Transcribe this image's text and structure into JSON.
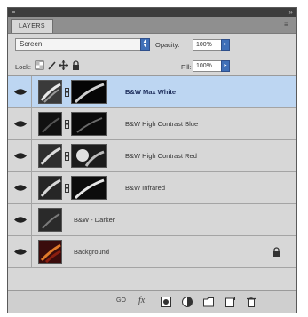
{
  "panel": {
    "tab_label": "LAYERS",
    "blend_mode": "Screen",
    "opacity_label": "Opacity:",
    "opacity_value": "100%",
    "lock_label": "Lock:",
    "fill_label": "Fill:",
    "fill_value": "100%"
  },
  "layers": [
    {
      "name": "B&W Max White",
      "selected": true,
      "bold": true
    },
    {
      "name": "B&W High Contrast Blue",
      "selected": false
    },
    {
      "name": "B&W High Contrast Red",
      "selected": false
    },
    {
      "name": "B&W Infrared",
      "selected": false
    },
    {
      "name": "B&W - Darker",
      "selected": false
    },
    {
      "name": "Background",
      "selected": false
    }
  ],
  "footer": {
    "link_label": "GO"
  },
  "colors": {
    "selection": "#bdd6f2",
    "panel_bg": "#d7d7d7",
    "accent_blue": "#3f6fb8"
  }
}
